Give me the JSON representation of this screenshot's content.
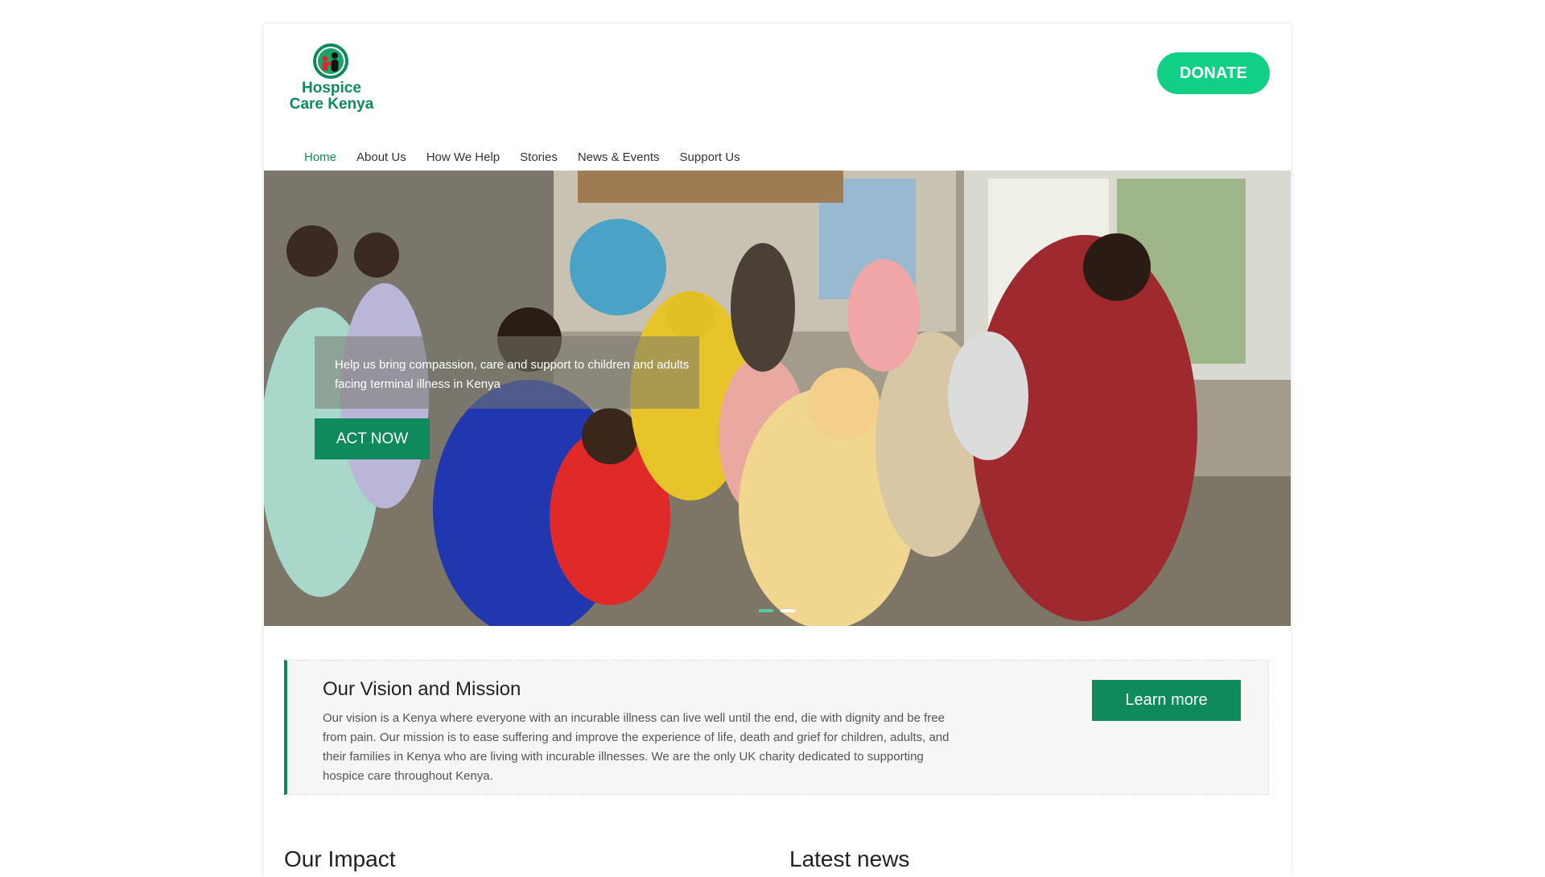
{
  "brand": {
    "logo_line1": "Hospice",
    "logo_line2": "Care Kenya",
    "color_primary": "#0e8a5c",
    "color_donate": "#12cf86"
  },
  "header": {
    "donate_label": "DONATE"
  },
  "nav": {
    "items": [
      {
        "label": "Home",
        "active": true
      },
      {
        "label": "About Us"
      },
      {
        "label": "How We Help"
      },
      {
        "label": "Stories"
      },
      {
        "label": "News & Events"
      },
      {
        "label": "Support Us"
      }
    ]
  },
  "hero": {
    "caption": "Help us bring compassion, care and support to children and adults facing terminal illness in Kenya",
    "cta_label": "ACT NOW",
    "slides_count": 2,
    "active_slide": 1
  },
  "vision": {
    "title": "Our Vision and Mission",
    "body": "Our vision is a Kenya where everyone with an incurable illness can live well until the end, die with dignity and be free from pain. Our mission is to ease suffering and improve the experience of life, death and grief for children, adults, and their families in Kenya who are living with incurable illnesses. We are the only UK charity dedicated to supporting hospice care throughout Kenya.",
    "button_label": "Learn more"
  },
  "sections": {
    "impact_title": "Our Impact",
    "news_title": "Latest news"
  }
}
